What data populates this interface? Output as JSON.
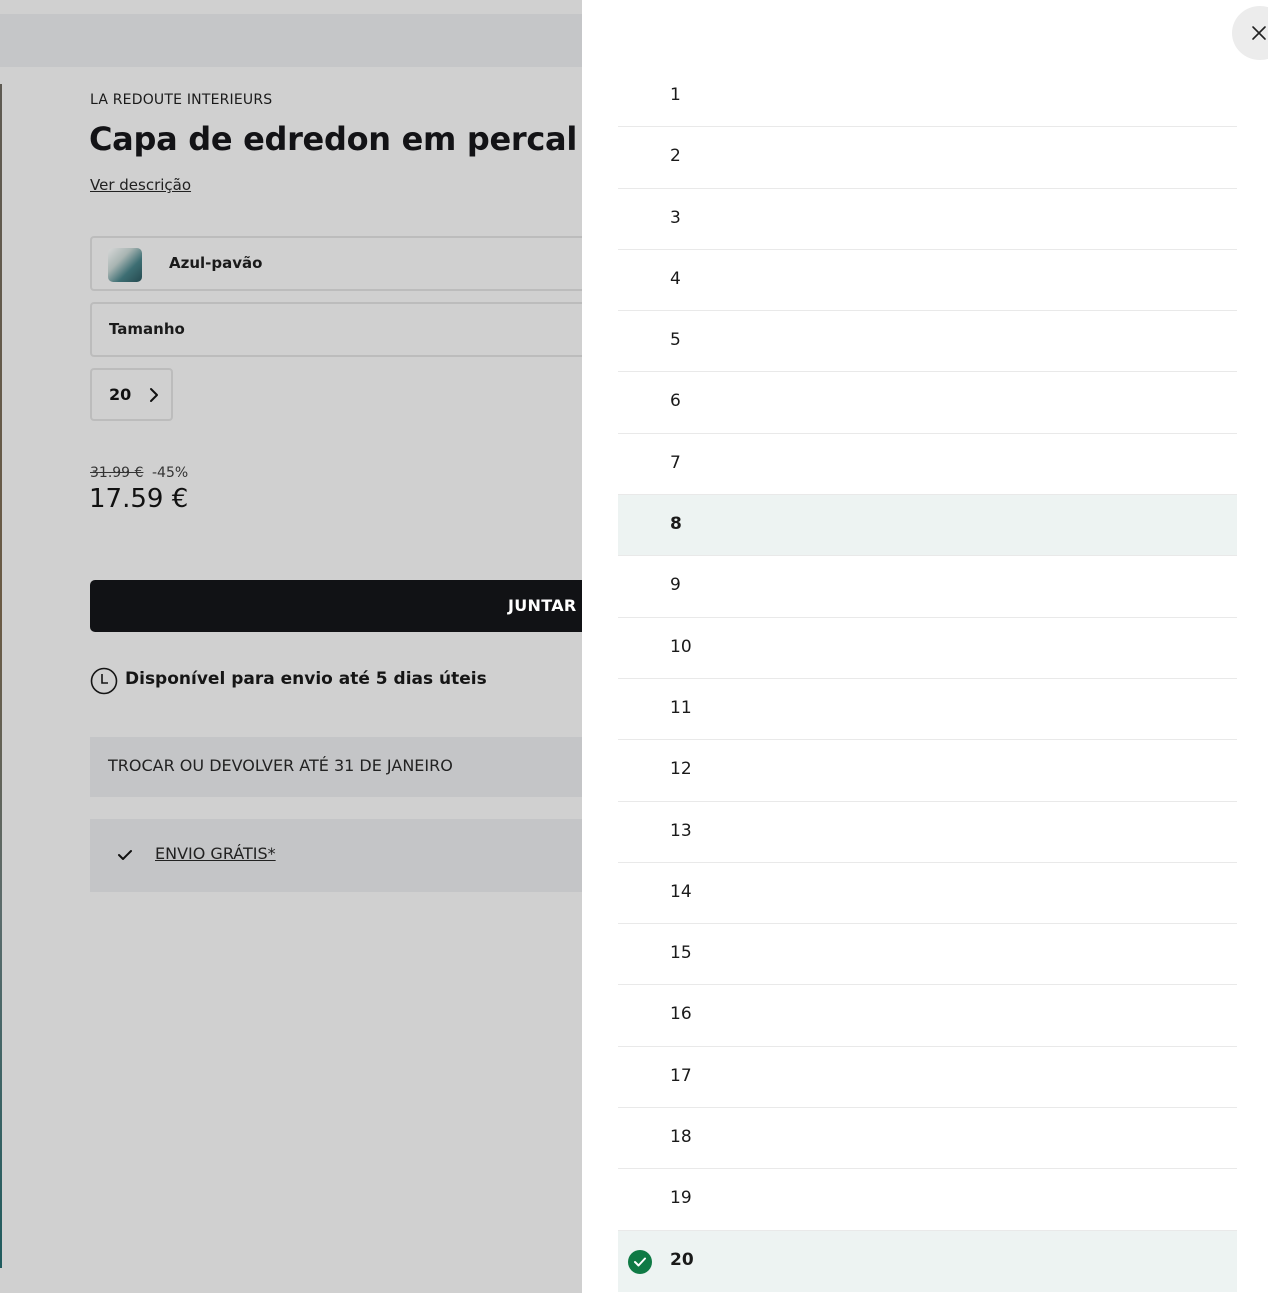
{
  "product": {
    "brand": "LA REDOUTE INTERIEURS",
    "title": "Capa de edredon em percal de",
    "description_link": "Ver descrição",
    "color": {
      "label": "Azul-pavão"
    },
    "size": {
      "label": "Tamanho"
    },
    "quantity": {
      "value": "20"
    },
    "old_price": "31.99 €",
    "discount": "-45%",
    "price": "17.59 €",
    "add_button_label": "JUNTAR",
    "availability": "Disponível para envio até 5 dias úteis",
    "returns": "TROCAR OU DEVOLVER ATÉ 31 DE JANEIRO",
    "shipping": "ENVIO GRÁTIS*"
  },
  "drawer": {
    "close_icon": "close-icon",
    "options": [
      "1",
      "2",
      "3",
      "4",
      "5",
      "6",
      "7",
      "8",
      "9",
      "10",
      "11",
      "12",
      "13",
      "14",
      "15",
      "16",
      "17",
      "18",
      "19",
      "20"
    ],
    "hovered": "8",
    "selected": "20"
  },
  "colors": {
    "button_dark": "#111215",
    "selected_green": "#0f7a45",
    "highlight_row": "#edf3f2"
  }
}
